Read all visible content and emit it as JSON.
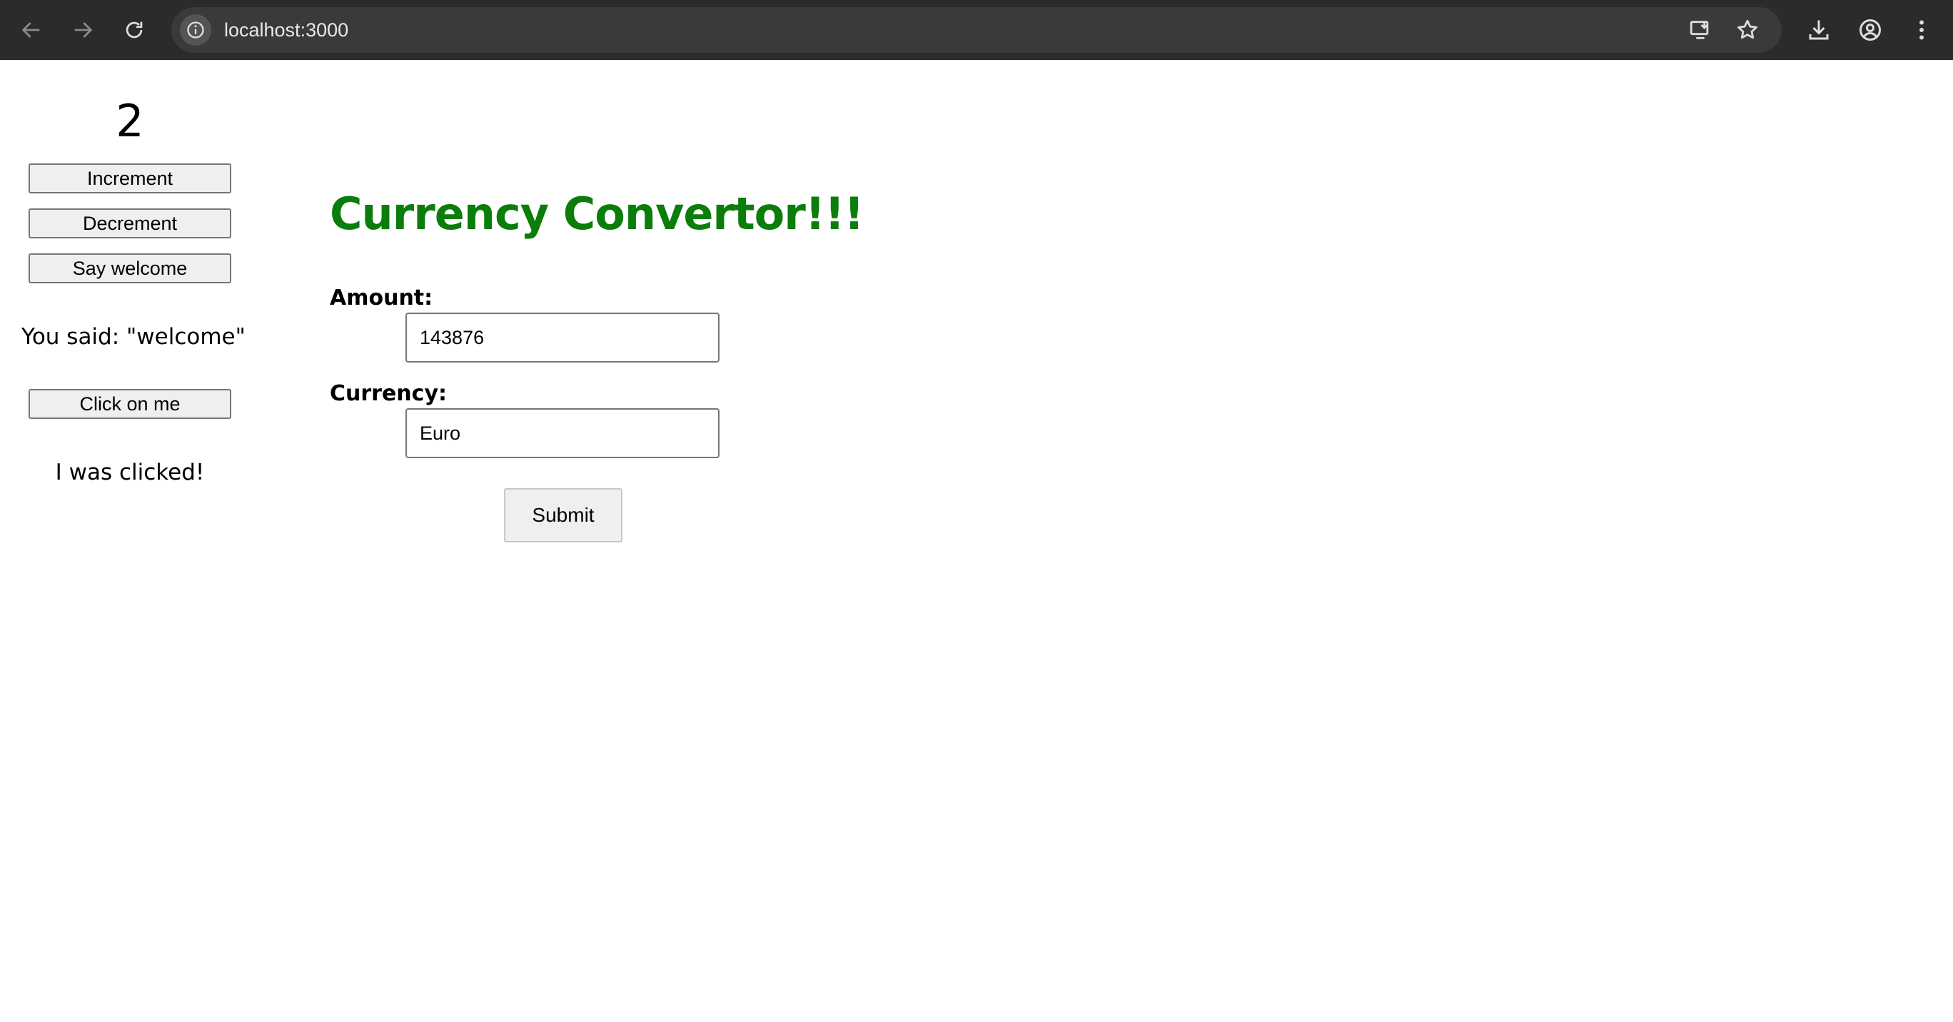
{
  "browser": {
    "url": "localhost:3000",
    "icons": {
      "back": "arrow-left-icon",
      "forward": "arrow-right-icon",
      "reload": "reload-icon",
      "site_info": "info-icon",
      "install": "install-app-icon",
      "bookmark": "star-icon",
      "downloads": "download-icon",
      "profile": "profile-icon",
      "menu": "kebab-menu-icon"
    }
  },
  "counter": {
    "value": "2",
    "increment_label": "Increment",
    "decrement_label": "Decrement",
    "say_welcome_label": "Say welcome",
    "said_text": "You said: \"welcome\"",
    "click_label": "Click on me",
    "clicked_text": "I was clicked!"
  },
  "converter": {
    "title": "Currency Convertor!!!",
    "amount_label": "Amount:",
    "amount_value": "143876",
    "currency_label": "Currency:",
    "currency_value": "Euro",
    "submit_label": "Submit"
  },
  "colors": {
    "heading": "#0a7d0a",
    "browser_bar": "#2b2b2b",
    "omnibox": "#3a3a3a"
  }
}
